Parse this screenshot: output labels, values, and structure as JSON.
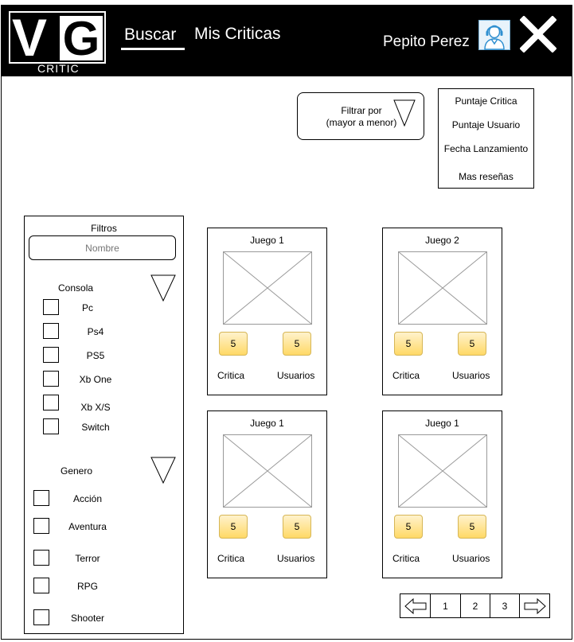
{
  "header": {
    "logo_letters_v": "V",
    "logo_letters_g": "G",
    "logo_sub": "CRITIC",
    "nav": [
      "Buscar",
      "Mis Criticas"
    ],
    "active_nav": "Buscar",
    "user_name": "Pepito Perez",
    "icons": {
      "avatar": "user-avatar-icon",
      "close": "close-icon"
    }
  },
  "sort": {
    "label_line1": "Filtrar por",
    "label_line2": "(mayor a menor)",
    "options": [
      "Puntaje Critica",
      "Puntaje Usuario",
      "Fecha Lanzamiento",
      "Mas reseñas"
    ]
  },
  "filters": {
    "title": "Filtros",
    "name_placeholder": "Nombre",
    "console_title": "Consola",
    "consoles": [
      "Pc",
      "Ps4",
      "PS5",
      "Xb One",
      "Xb X/S",
      "Switch"
    ],
    "genre_title": "Genero",
    "genres": [
      "Acción",
      "Aventura",
      "Terror",
      "RPG",
      "Shooter"
    ]
  },
  "games": [
    {
      "title": "Juego 1",
      "critic_score": "5",
      "user_score": "5",
      "critic_label": "Critica",
      "user_label": "Usuarios"
    },
    {
      "title": "Juego 2",
      "critic_score": "5",
      "user_score": "5",
      "critic_label": "Critica",
      "user_label": "Usuarios"
    },
    {
      "title": "Juego 1",
      "critic_score": "5",
      "user_score": "5",
      "critic_label": "Critica",
      "user_label": "Usuarios"
    },
    {
      "title": "Juego 1",
      "critic_score": "5",
      "user_score": "5",
      "critic_label": "Critica",
      "user_label": "Usuarios"
    }
  ],
  "pagination": {
    "pages": [
      "1",
      "2",
      "3"
    ],
    "prev_icon": "arrow-left-icon",
    "next_icon": "arrow-right-icon"
  },
  "colors": {
    "header_bg": "#000000",
    "score_fill": "#ffd966",
    "score_border": "#d6b656"
  }
}
